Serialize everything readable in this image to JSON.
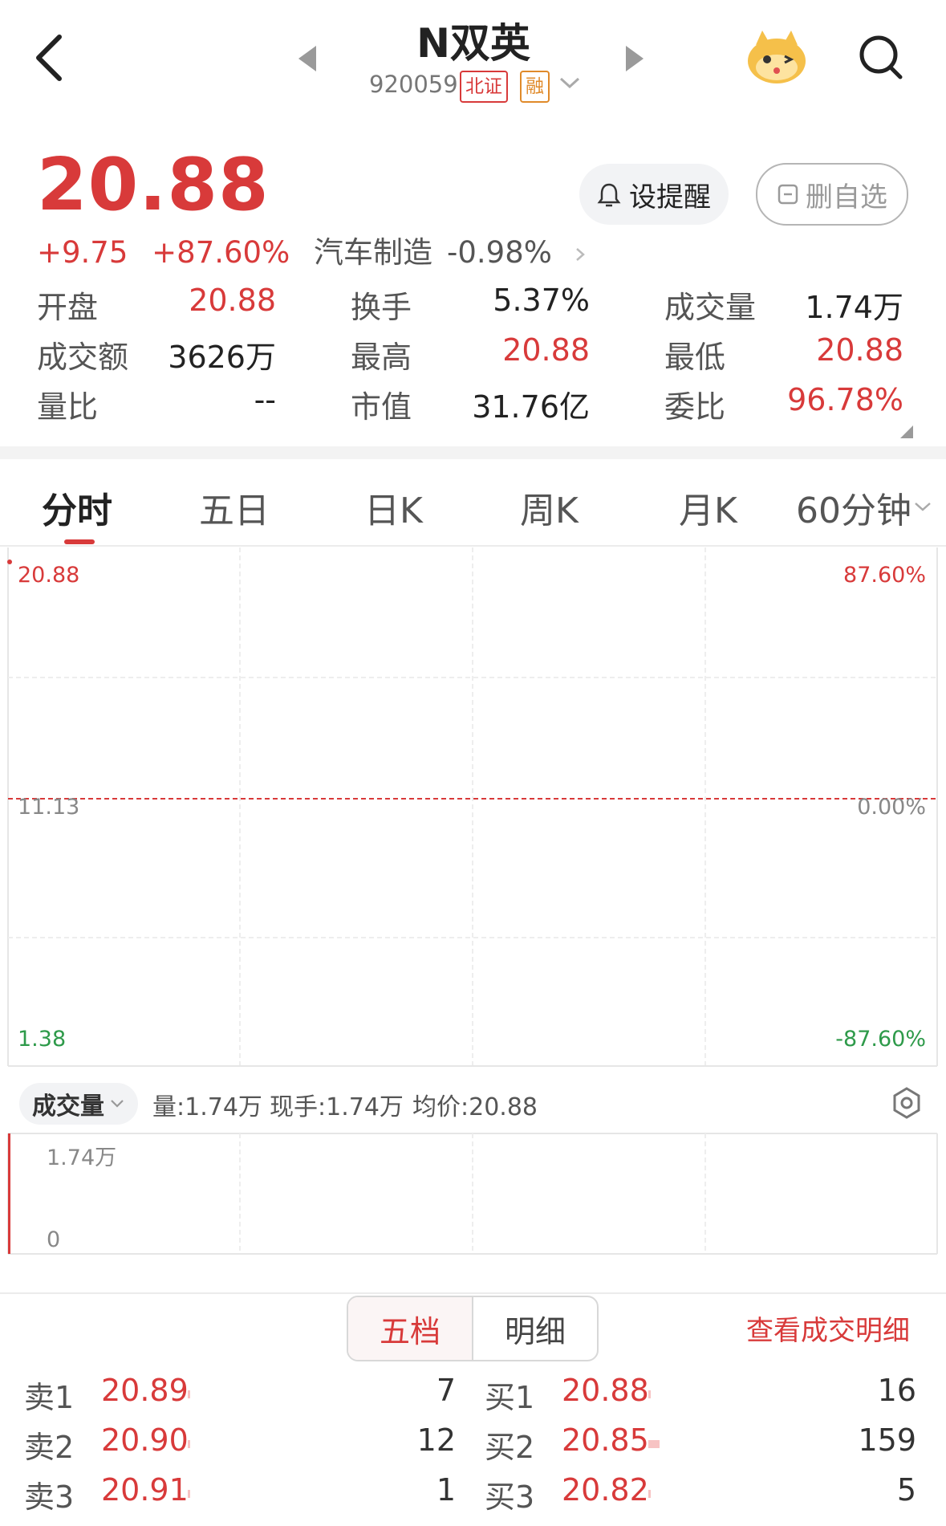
{
  "header": {
    "stock_name": "N双英",
    "stock_code": "920059",
    "tag_exchange": "北证",
    "tag_margin": "融"
  },
  "quote": {
    "price": "20.88",
    "change": "+9.75",
    "change_pct": "+87.60%",
    "sector_name": "汽车制造",
    "sector_change": "-0.98%",
    "alert_label": "设提醒",
    "watchlist_label": "删自选"
  },
  "stats": [
    {
      "label": "开盘",
      "value": "20.88",
      "color": "red"
    },
    {
      "label": "换手",
      "value": "5.37%",
      "color": "dark"
    },
    {
      "label": "成交量",
      "value": "1.74万",
      "color": "dark"
    },
    {
      "label": "成交额",
      "value": "3626万",
      "color": "dark"
    },
    {
      "label": "最高",
      "value": "20.88",
      "color": "red"
    },
    {
      "label": "最低",
      "value": "20.88",
      "color": "red"
    },
    {
      "label": "量比",
      "value": "--",
      "color": "dark"
    },
    {
      "label": "市值",
      "value": "31.76亿",
      "color": "dark"
    },
    {
      "label": "委比",
      "value": "96.78%",
      "color": "red"
    }
  ],
  "tabs": [
    "分时",
    "五日",
    "日K",
    "周K",
    "月K",
    "60分钟"
  ],
  "chart_data": {
    "type": "line",
    "title": "",
    "price_axis": {
      "max": "20.88",
      "mid": "11.13",
      "min": "1.38"
    },
    "pct_axis": {
      "max": "87.60%",
      "mid": "0.00%",
      "min": "-87.60%"
    },
    "ylim": [
      1.38,
      20.88
    ],
    "prev_close": 11.13,
    "series": [
      {
        "values": [
          20.88
        ]
      }
    ]
  },
  "volume": {
    "selector_label": "成交量",
    "info_vol": "量:1.74万",
    "info_current": "现手:1.74万",
    "info_avg": "均价:20.88",
    "axis_top": "1.74万",
    "axis_bottom": "0",
    "values": [
      17400
    ],
    "max": 17400
  },
  "orderbook": {
    "tab_active": "五档",
    "tab_other": "明细",
    "view_detail": "查看成交明细",
    "sell": [
      {
        "label": "卖1",
        "price": "20.89",
        "qty": "7"
      },
      {
        "label": "卖2",
        "price": "20.90",
        "qty": "12"
      },
      {
        "label": "卖3",
        "price": "20.91",
        "qty": "1"
      }
    ],
    "buy": [
      {
        "label": "买1",
        "price": "20.88",
        "qty": "16"
      },
      {
        "label": "买2",
        "price": "20.85",
        "qty": "159"
      },
      {
        "label": "买3",
        "price": "20.82",
        "qty": "5"
      }
    ]
  },
  "colors": {
    "up": "#d83a3a",
    "down": "#2e9a4a",
    "accent": "#d83a3a"
  }
}
